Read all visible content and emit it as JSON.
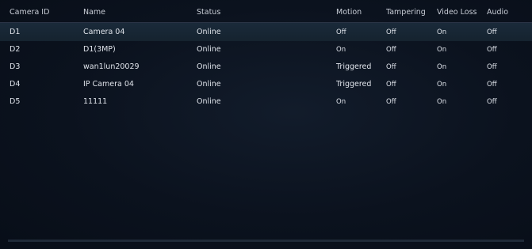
{
  "headers": {
    "camera_id": "Camera ID",
    "name": "Name",
    "status": "Status",
    "motion": "Motion",
    "tampering": "Tampering",
    "video_loss": "Video Loss",
    "audio": "Audio"
  },
  "rows": [
    {
      "camera_id": "D1",
      "name": "Camera 04",
      "status": "Online",
      "motion": "Off",
      "tampering": "Off",
      "video_loss": "On",
      "audio": "Off"
    },
    {
      "camera_id": "D2",
      "name": "D1(3MP)",
      "status": "Online",
      "motion": "On",
      "tampering": "Off",
      "video_loss": "On",
      "audio": "Off"
    },
    {
      "camera_id": "D3",
      "name": "wan1lun20029",
      "status": "Online",
      "motion": "Triggered",
      "tampering": "Off",
      "video_loss": "On",
      "audio": "Off"
    },
    {
      "camera_id": "D4",
      "name": "IP Camera 04",
      "status": "Online",
      "motion": "Triggered",
      "tampering": "Off",
      "video_loss": "On",
      "audio": "Off"
    },
    {
      "camera_id": "D5",
      "name": "11111",
      "status": "Online",
      "motion": "On",
      "tampering": "Off",
      "video_loss": "On",
      "audio": "Off"
    }
  ],
  "selected_row": 0,
  "colors": {
    "background": "#0a111d",
    "selected_row": "#1a2a3a",
    "text": "#dfe3ea",
    "divider": "#2a3446"
  }
}
